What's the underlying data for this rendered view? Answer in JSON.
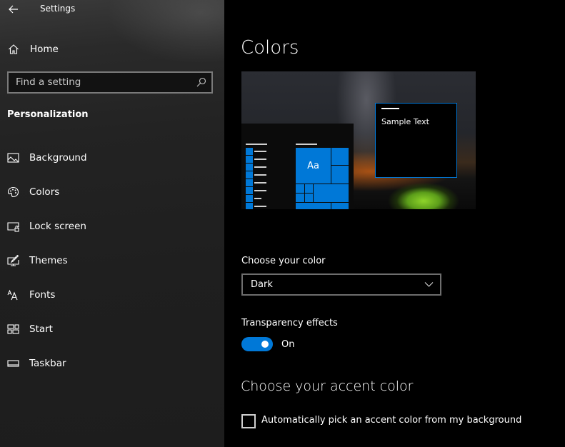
{
  "window": {
    "title": "Settings",
    "back_icon": "arrow-left-icon"
  },
  "sidebar": {
    "home": {
      "label": "Home",
      "icon": "home-icon"
    },
    "search": {
      "placeholder": "Find a setting",
      "value": "",
      "icon": "search-icon"
    },
    "section_title": "Personalization",
    "items": [
      {
        "label": "Background",
        "icon": "picture-icon",
        "selected": false
      },
      {
        "label": "Colors",
        "icon": "palette-icon",
        "selected": true
      },
      {
        "label": "Lock screen",
        "icon": "lock-screen-icon",
        "selected": false
      },
      {
        "label": "Themes",
        "icon": "themes-icon",
        "selected": false
      },
      {
        "label": "Fonts",
        "icon": "fonts-icon",
        "selected": false
      },
      {
        "label": "Start",
        "icon": "start-icon",
        "selected": false
      },
      {
        "label": "Taskbar",
        "icon": "taskbar-icon",
        "selected": false
      }
    ]
  },
  "main": {
    "title": "Colors",
    "preview": {
      "sample_text": "Sample Text",
      "tile_text": "Aa",
      "accent_color": "#0078d7"
    },
    "choose_color": {
      "label": "Choose your color",
      "selected": "Dark"
    },
    "transparency": {
      "label": "Transparency effects",
      "state_label": "On",
      "on": true
    },
    "accent": {
      "heading": "Choose your accent color",
      "auto_pick_label": "Automatically pick an accent color from my background",
      "auto_pick_checked": false
    }
  },
  "colors": {
    "accent": "#0078d7",
    "main_bg": "#000000",
    "sidebar_bg": "#1f1f1f"
  }
}
